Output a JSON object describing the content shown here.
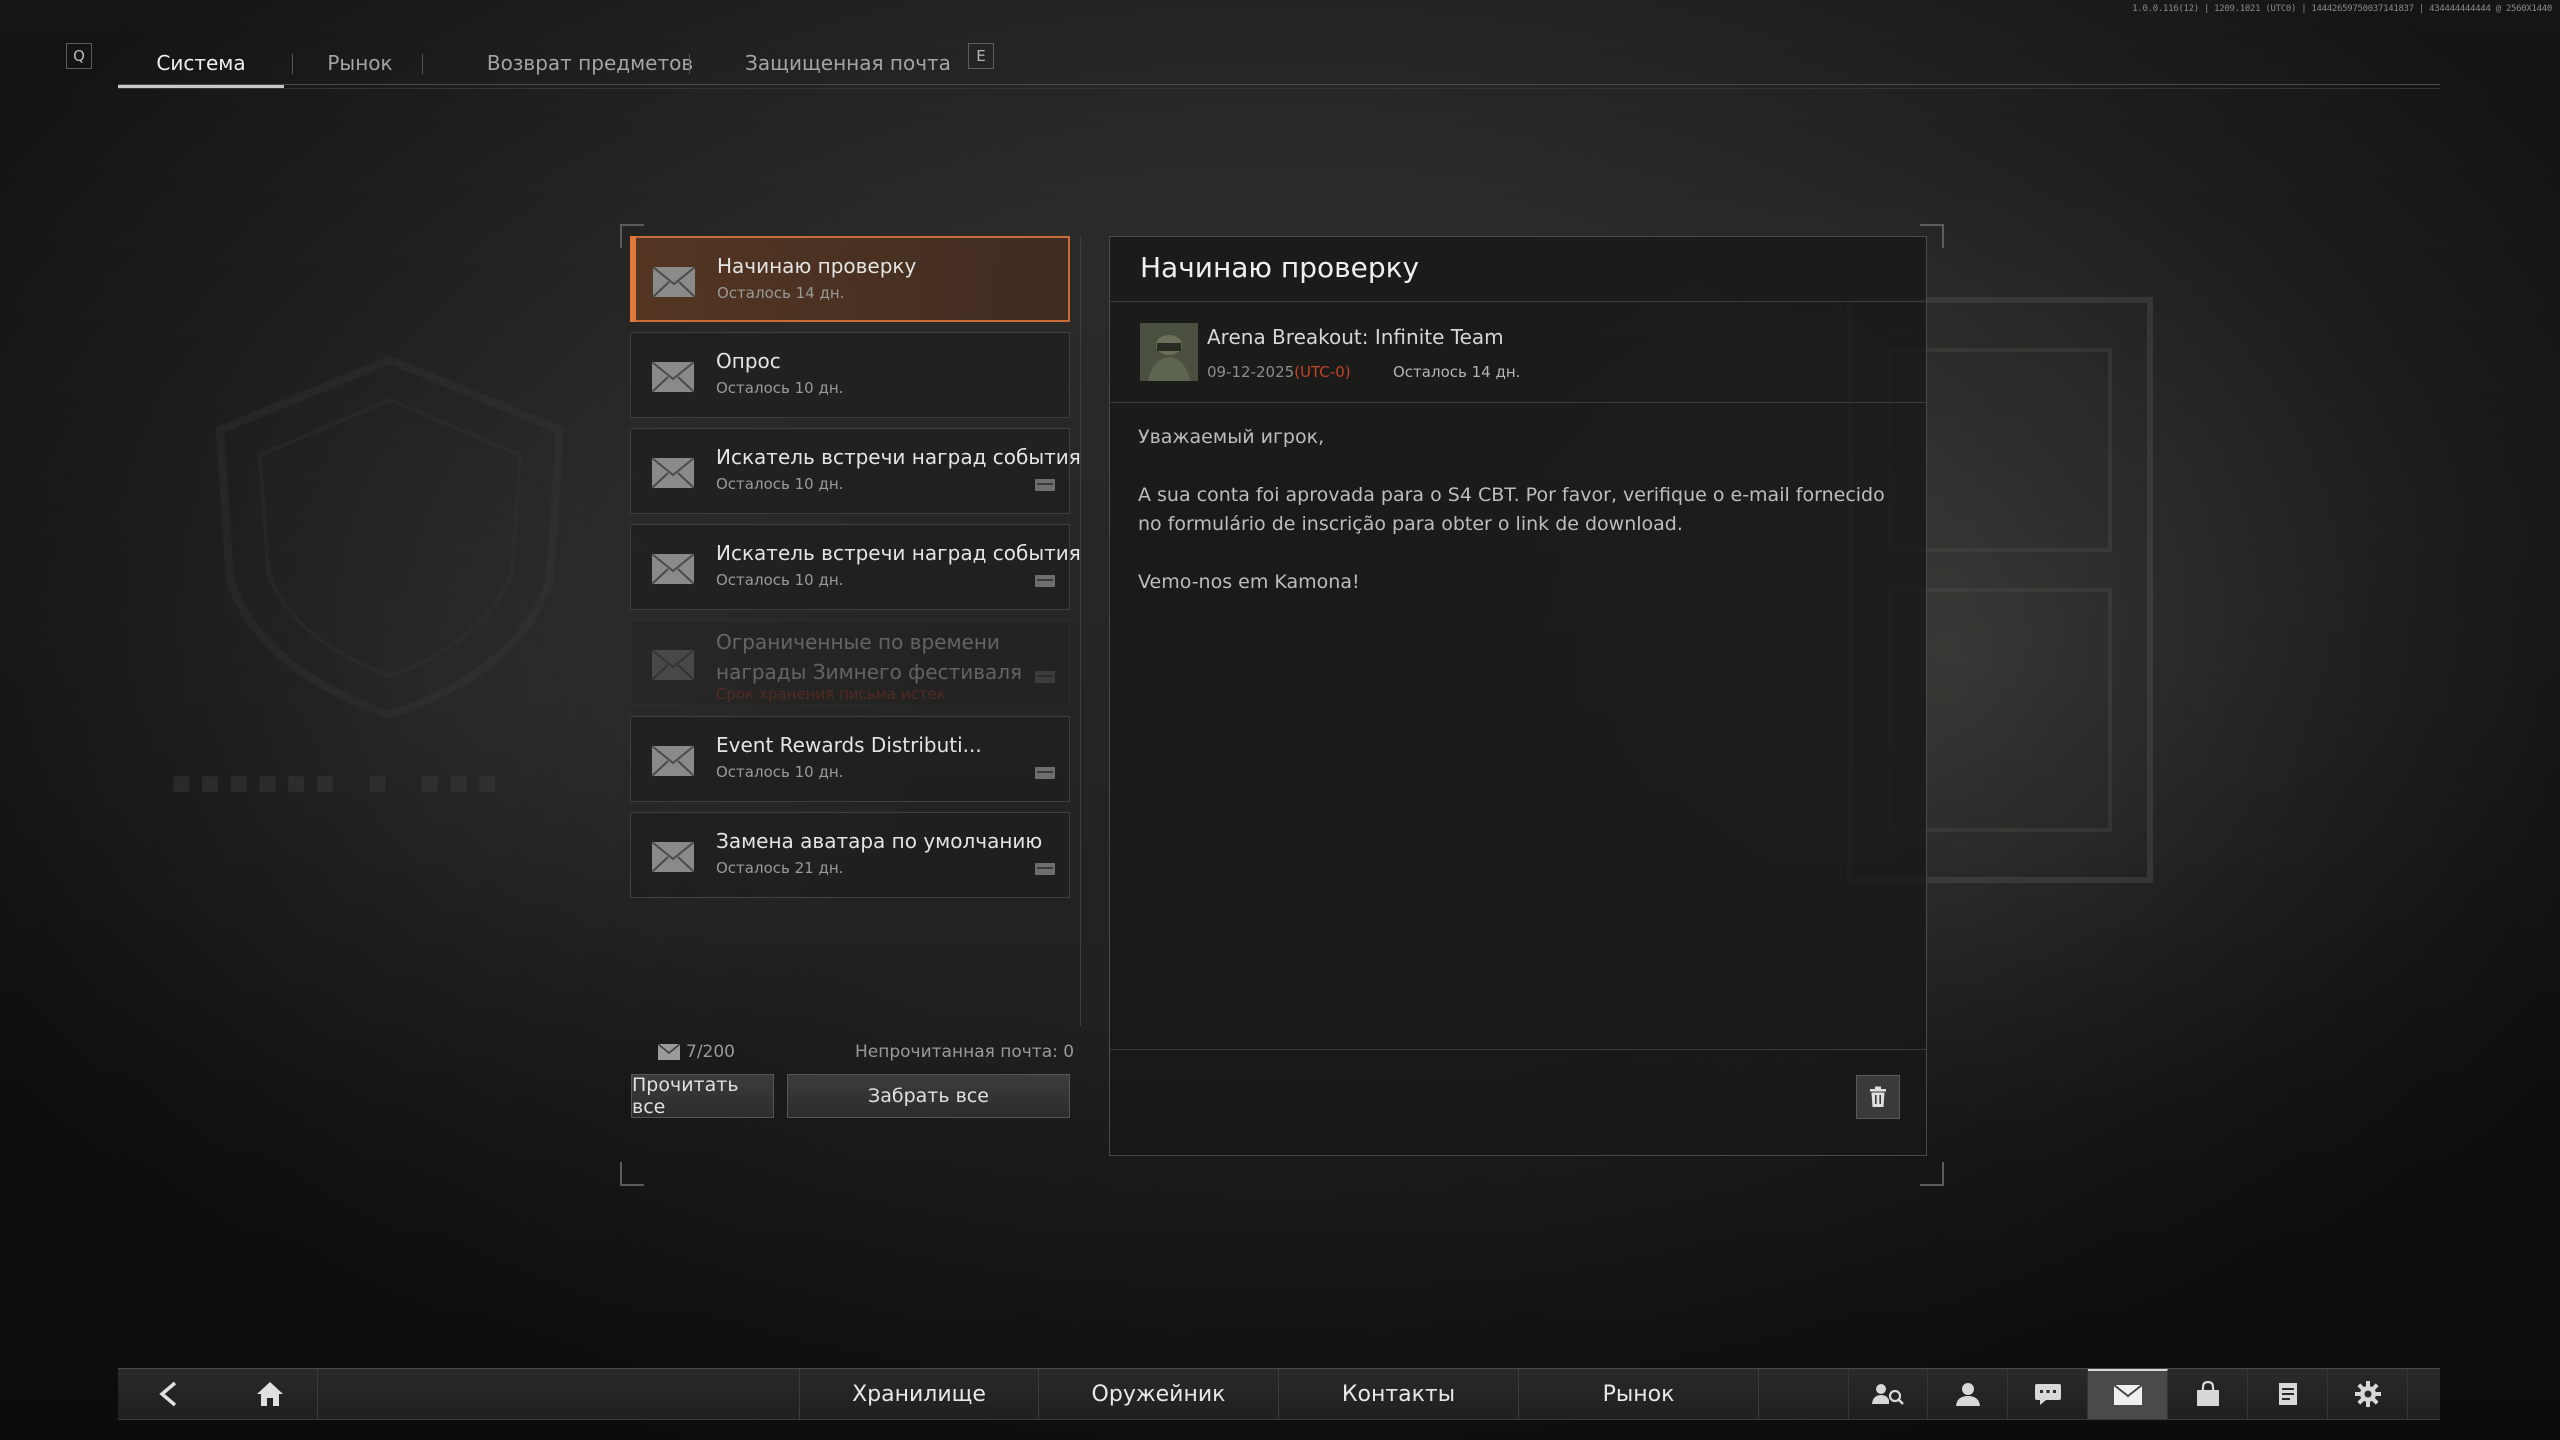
{
  "build_info": "1.0.0.116(12) | 1209.1021 (UTC0) | 14442659750037141837 | 434444444444 @ 2560X1440",
  "top_tabs": {
    "key_left": "Q",
    "key_right": "E",
    "items": [
      {
        "label": "Система",
        "active": true
      },
      {
        "label": "Рынок",
        "active": false
      },
      {
        "label": "Возврат предметов",
        "active": false
      },
      {
        "label": "Защищенная почта",
        "active": false
      }
    ]
  },
  "mail_list": [
    {
      "title": "Начинаю проверку",
      "subtitle": "Осталось 14 дн.",
      "selected": true
    },
    {
      "title": "Опрос",
      "subtitle": "Осталось 10 дн."
    },
    {
      "title": "Искатель встречи наград события",
      "subtitle": "Осталось 10 дн.",
      "attachment": true
    },
    {
      "title": "Искатель встречи наград события",
      "subtitle": "Осталось 10 дн.",
      "attachment": true
    },
    {
      "title": "Ограниченные по времени награды Зимнего фестиваля",
      "subtitle": "Срок хранения письма истек",
      "attachment": true,
      "expired": true
    },
    {
      "title": "Event Rewards Distributi...",
      "subtitle": "Осталось 10 дн.",
      "attachment": true
    },
    {
      "title": "Замена аватара по умолчанию",
      "subtitle": "Осталось 21 дн.",
      "attachment": true
    }
  ],
  "mail_footer": {
    "count": "7/200",
    "unread": "Непрочитанная почта: 0",
    "read_all": "Прочитать все",
    "claim_all": "Забрать все"
  },
  "message": {
    "title": "Начинаю проверку",
    "sender": "Arena Breakout: Infinite Team",
    "date": "09-12-2025",
    "timezone": "(UTC-0)",
    "remaining": "Осталось 14 дн.",
    "paragraphs": [
      "Уважаемый игрок,",
      "A sua conta foi aprovada para o S4 CBT. Por favor, verifique o e-mail fornecido no formulário de inscrição para obter o link de download.",
      "Vemo-nos em Kamona!"
    ]
  },
  "bottom_nav": {
    "items": [
      "Хранилище",
      "Оружейник",
      "Контакты",
      "Рынок"
    ],
    "icons": [
      "friends-search-icon",
      "profile-icon",
      "chat-icon",
      "mail-icon",
      "store-bag-icon",
      "tasks-icon",
      "settings-gear-icon"
    ],
    "active_icon": "mail-icon"
  },
  "colors": {
    "accent": "#e07a3a",
    "timezone": "#c0432a",
    "expired": "#b03020"
  }
}
